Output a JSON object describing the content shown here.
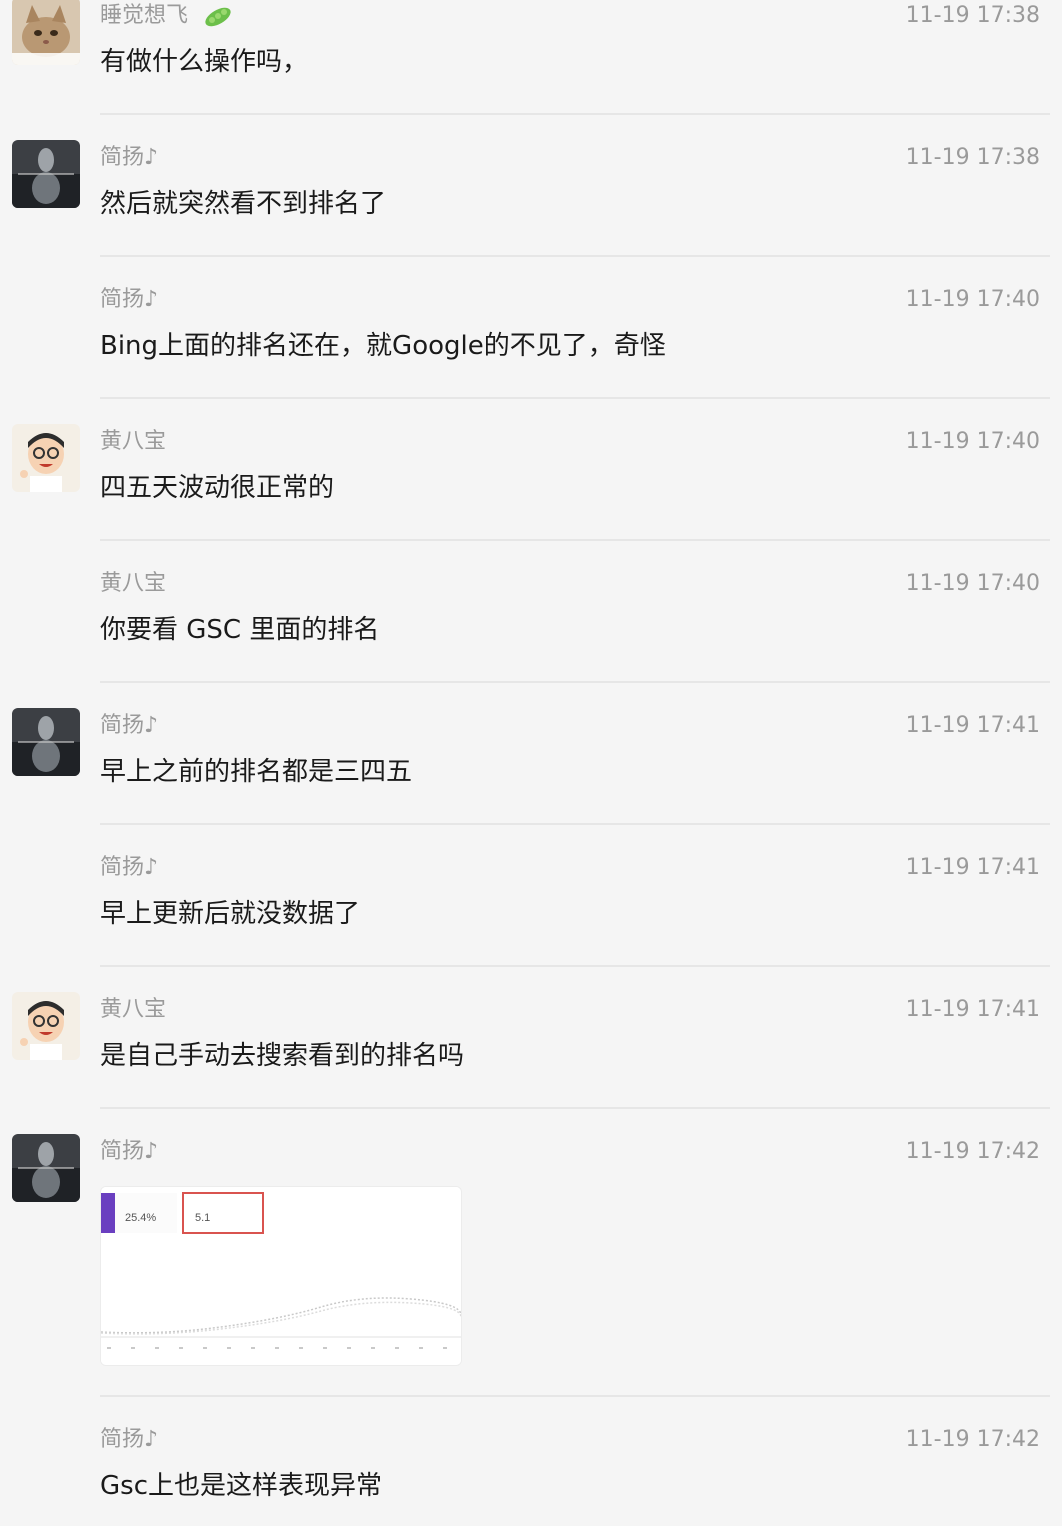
{
  "messages": [
    {
      "sender": "睡觉想飞",
      "time": "11-19 17:38",
      "text": "有做什么操作吗，"
    },
    {
      "sender": "简扬♪",
      "time": "11-19 17:38",
      "text": "然后就突然看不到排名了"
    },
    {
      "sender": "简扬♪",
      "time": "11-19 17:40",
      "text": "Bing上面的排名还在，就Google的不见了，奇怪"
    },
    {
      "sender": "黄八宝",
      "time": "11-19 17:40",
      "text": "四五天波动很正常的"
    },
    {
      "sender": "黄八宝",
      "time": "11-19 17:40",
      "text": "你要看 GSC 里面的排名"
    },
    {
      "sender": "简扬♪",
      "time": "11-19 17:41",
      "text": "早上之前的排名都是三四五"
    },
    {
      "sender": "简扬♪",
      "time": "11-19 17:41",
      "text": "早上更新后就没数据了"
    },
    {
      "sender": "黄八宝",
      "time": "11-19 17:41",
      "text": "是自己手动去搜索看到的排名吗"
    },
    {
      "sender": "简扬♪",
      "time": "11-19 17:42",
      "image": {
        "ctr": "25.4%",
        "position": "5.1"
      }
    },
    {
      "sender": "简扬♪",
      "time": "11-19 17:42",
      "text": "Gsc上也是这样表现异常"
    }
  ],
  "colors": {
    "background": "#f5f5f5",
    "accent": "#6a3fc0",
    "highlight_border": "#d9534f"
  }
}
